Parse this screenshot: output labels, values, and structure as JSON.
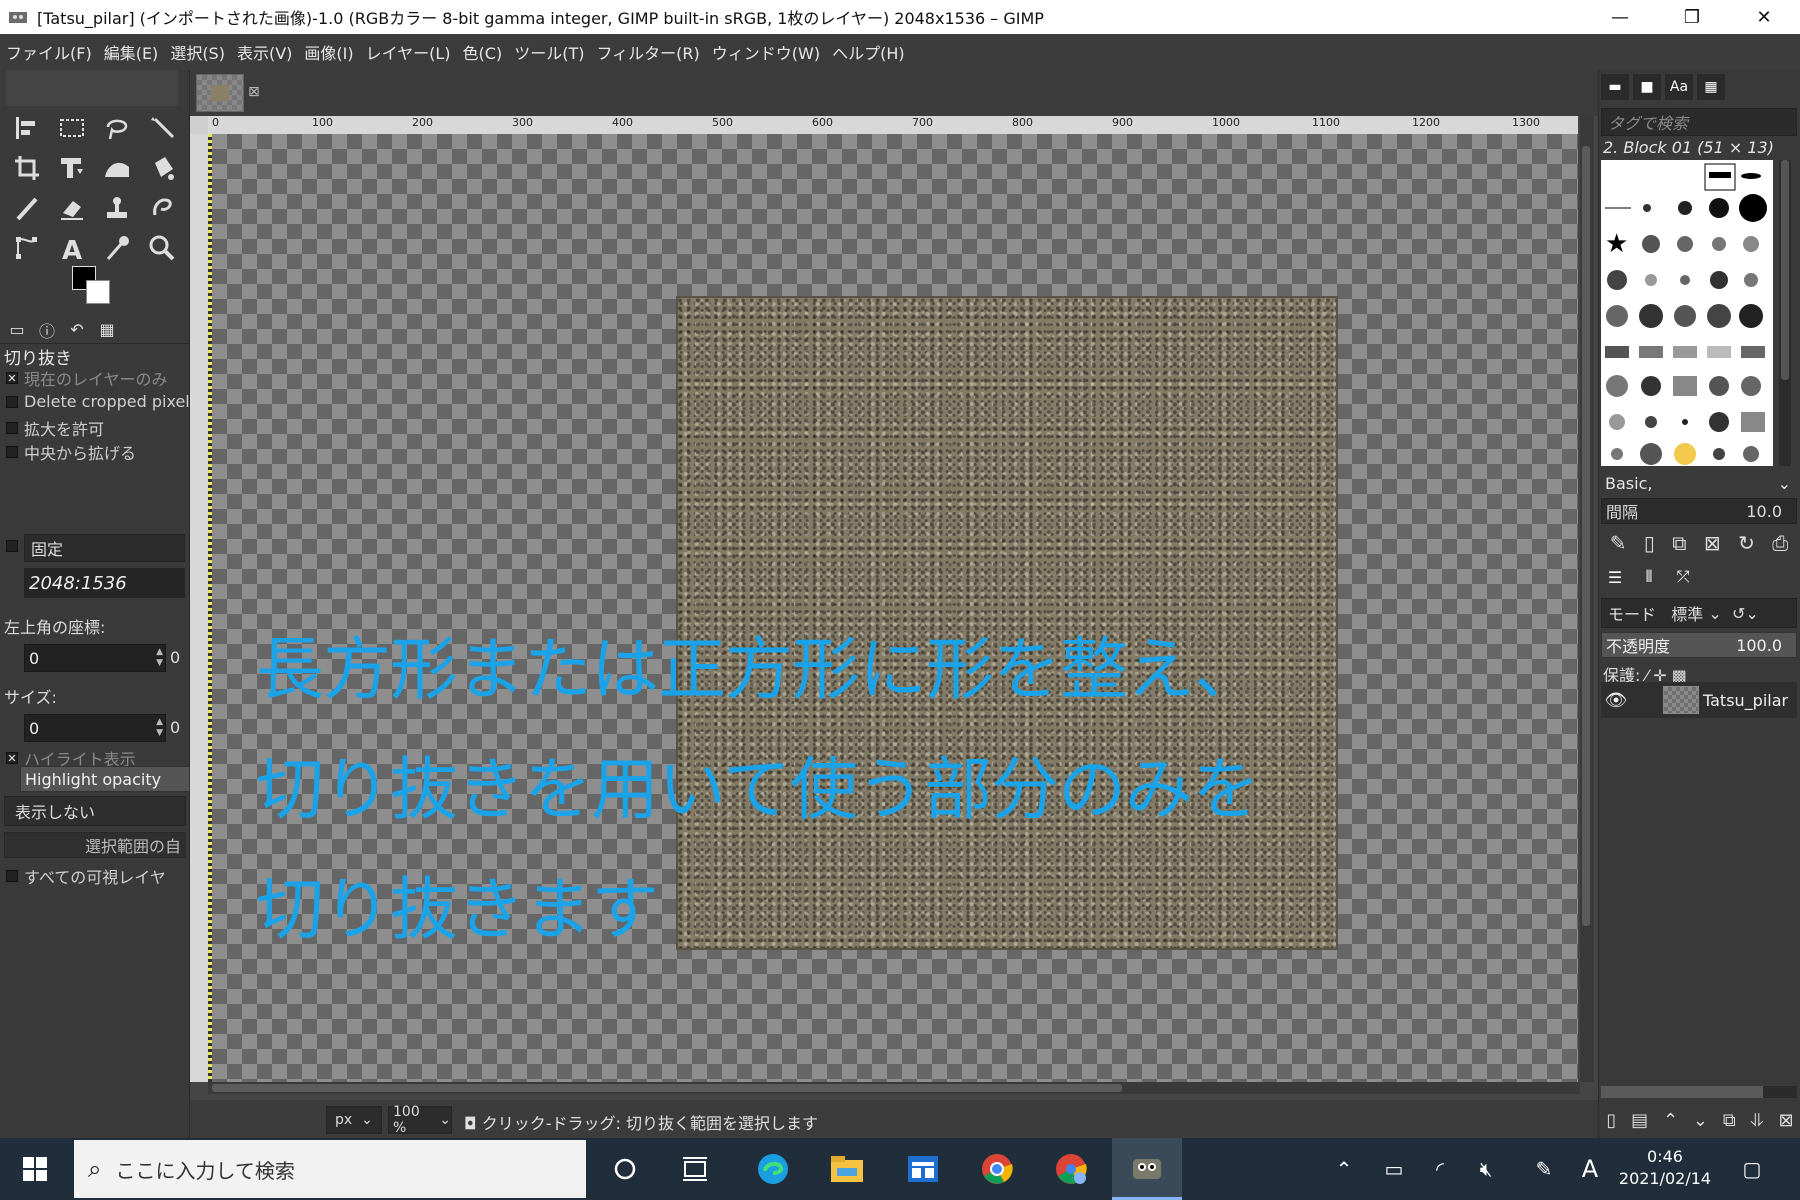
{
  "window": {
    "title": "[Tatsu_pilar] (インポートされた画像)-1.0 (RGBカラー 8-bit gamma integer, GIMP built-in sRGB, 1枚のレイヤー) 2048x1536 – GIMP",
    "controls": [
      "minimize",
      "restore",
      "close"
    ]
  },
  "menu": [
    "ファイル(F)",
    "編集(E)",
    "選択(S)",
    "表示(V)",
    "画像(I)",
    "レイヤー(L)",
    "色(C)",
    "ツール(T)",
    "フィルター(R)",
    "ウィンドウ(W)",
    "ヘルプ(H)"
  ],
  "tools": [
    "align-icon",
    "rect-select-icon",
    "free-select-icon",
    "fuzzy-select-icon",
    "crop-icon",
    "transform-icon",
    "warp-icon",
    "bucket-fill-icon",
    "paintbrush-icon",
    "eraser-icon",
    "clone-icon",
    "smudge-icon",
    "paths-icon",
    "text-icon",
    "color-picker-icon",
    "zoom-icon"
  ],
  "colors": {
    "foreground": "#000000",
    "background": "#ffffff",
    "overlay_text": "#1aa3e8"
  },
  "tool_options": {
    "title": "切り抜き",
    "current_layer_only": "現在のレイヤーのみ",
    "delete_cropped": "Delete cropped pixels",
    "allow_growing": "拡大を許可",
    "expand_from_center": "中央から拡げる",
    "fixed": "固定",
    "ratio": "2048:1536",
    "position_label": "左上角の座標:",
    "position_x": "0",
    "position_y": "0",
    "size_label": "サイズ:",
    "size_w": "0",
    "size_h": "0",
    "highlight": "ハイライト表示",
    "highlight_opacity": "Highlight opacity",
    "guides": "表示しない",
    "auto_shrink": "選択範囲の自",
    "shrink_merged": "すべての可視レイヤ"
  },
  "ruler": {
    "labels": [
      "0",
      "100",
      "200",
      "300",
      "400",
      "500",
      "600",
      "700",
      "800",
      "900",
      "1000",
      "1100",
      "1200",
      "1300"
    ]
  },
  "overlay": {
    "line1": "長方形または正方形に形を整え、",
    "line2": "切り抜きを用いて使う部分のみを",
    "line3": "切り抜きます"
  },
  "status": {
    "unit": "px",
    "zoom": "100 %",
    "message": "クリック-ドラッグ: 切り抜く範囲を選択します"
  },
  "brushes": {
    "tag_placeholder": "タグで検索",
    "selected": "2. Block 01 (51 × 13)",
    "preset": "Basic,",
    "spacing_label": "間隔",
    "spacing_value": "10.0"
  },
  "layers": {
    "mode_label": "モード",
    "mode_value": "標準",
    "opacity_label": "不透明度",
    "opacity_value": "100.0",
    "lock_label": "保護:",
    "layer_name": "Tatsu_pilar"
  },
  "taskbar": {
    "search_placeholder": "ここに入力して検索",
    "ime": "A",
    "time": "0:46",
    "date": "2021/02/14"
  }
}
